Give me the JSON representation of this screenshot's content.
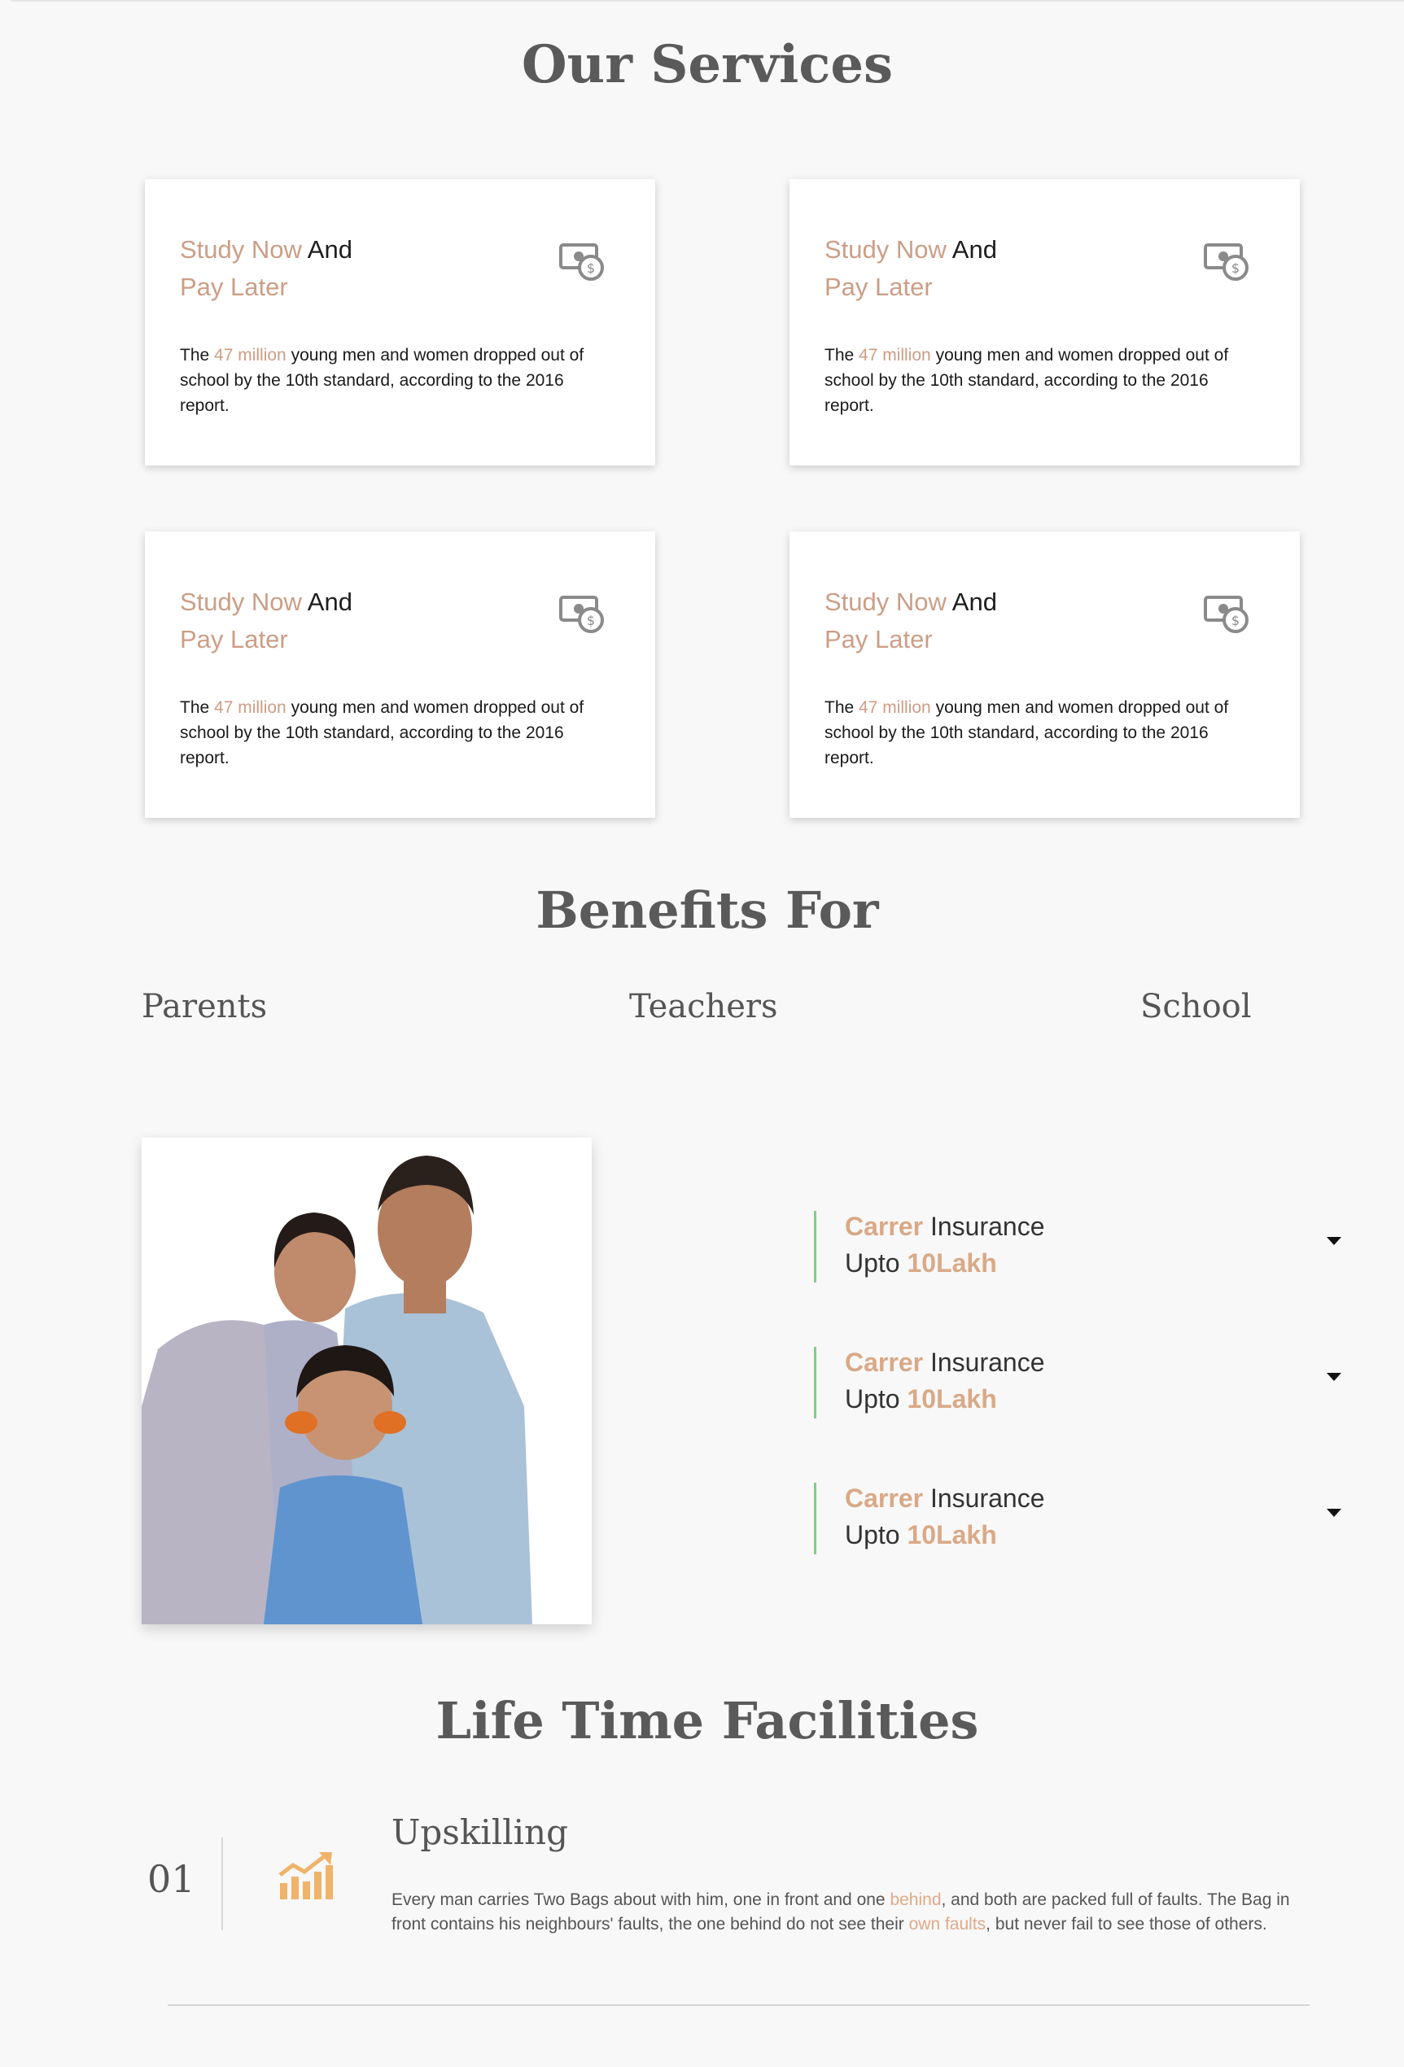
{
  "services": {
    "title": "Our Services",
    "cards": [
      {
        "title_accent": "Study Now",
        "title_plain": " And",
        "title_line2": "Pay Later",
        "icon": "money-icon",
        "text_start": "The ",
        "text_accent": "47 million",
        "text_end": " young men and women dropped out of school by the 10th standard, according to the 2016 report."
      },
      {
        "title_accent": "Study Now",
        "title_plain": " And",
        "title_line2": "Pay Later",
        "icon": "money-icon",
        "text_start": "The ",
        "text_accent": "47 million",
        "text_end": " young men and women dropped out of school by the 10th standard, according to the 2016 report."
      },
      {
        "title_accent": "Study Now",
        "title_plain": " And",
        "title_line2": "Pay Later",
        "icon": "money-icon",
        "text_start": "The ",
        "text_accent": "47 million",
        "text_end": " young men and women dropped out of school by the 10th standard, according to the 2016 report."
      },
      {
        "title_accent": "Study Now",
        "title_plain": " And",
        "title_line2": "Pay Later",
        "icon": "money-icon",
        "text_start": "The ",
        "text_accent": "47 million",
        "text_end": " young men and women dropped out of school by the 10th standard, according to the 2016 report."
      }
    ]
  },
  "benefits": {
    "title": "Benefits For",
    "tabs": [
      "Parents",
      "Teachers",
      "School"
    ],
    "items": [
      {
        "hl1": "Carrer",
        "t1": " Insurance",
        "t2": "Upto ",
        "hl2": "10Lakh"
      },
      {
        "hl1": "Carrer",
        "t1": " Insurance",
        "t2": "Upto ",
        "hl2": "10Lakh"
      },
      {
        "hl1": "Carrer",
        "t1": " Insurance",
        "t2": "Upto ",
        "hl2": "10Lakh"
      }
    ]
  },
  "facilities": {
    "title": "Life Time Facilities",
    "item": {
      "number": "01",
      "icon": "growth-chart-icon",
      "title": "Upskilling",
      "text_1": "Every man carries Two Bags about with him, one in front and one ",
      "hl_1": "behind",
      "text_2": ", and both are packed full of faults. The Bag in front contains his neighbours' faults, the one behind do not see their ",
      "hl_2": "own faults",
      "text_3": ", but never fail to see those of others."
    }
  },
  "colors": {
    "accent": "#cc9e86",
    "green_bar": "#7fce84",
    "icon_orange": "#f0b36a"
  }
}
